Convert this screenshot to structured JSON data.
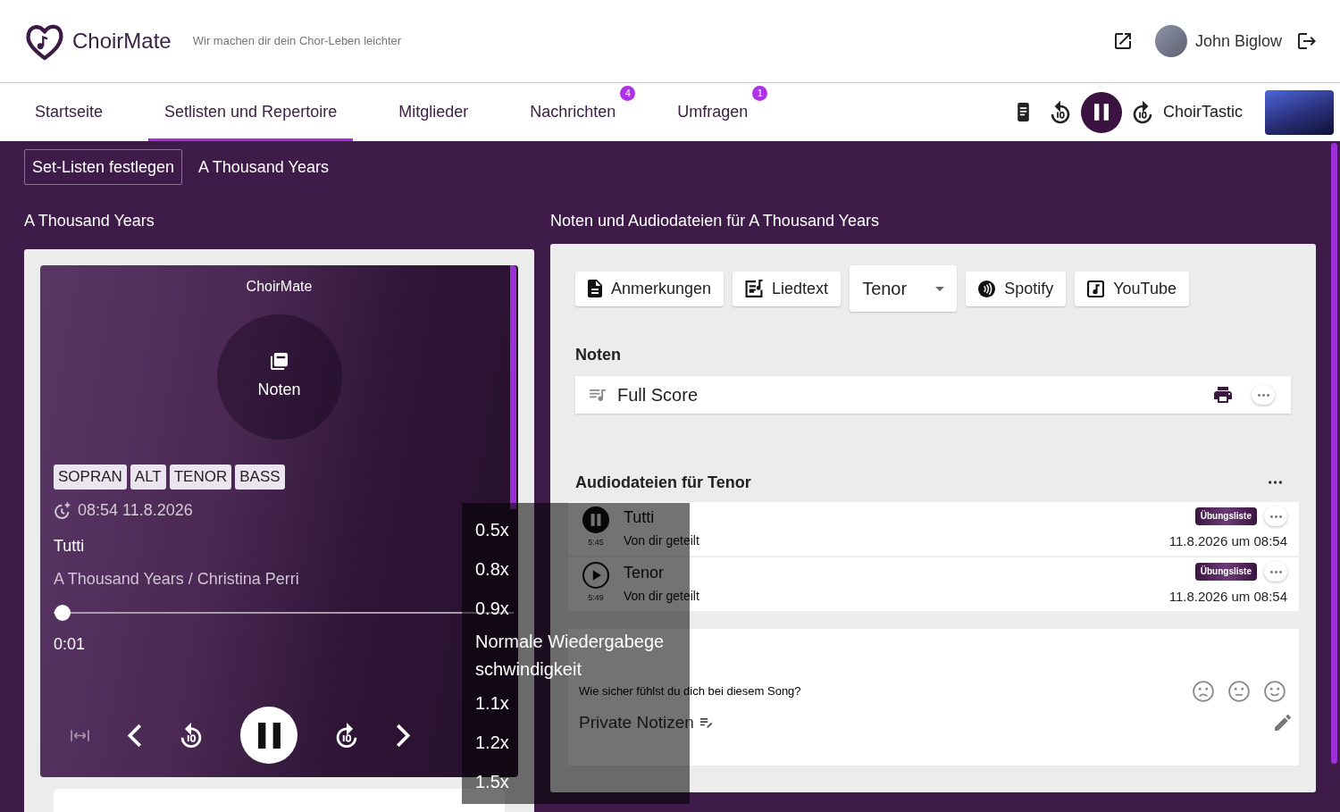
{
  "header": {
    "brand": "ChoirMate",
    "tagline": "Wir machen dir dein Chor-Leben leichter",
    "user_name": "John Biglow"
  },
  "nav": {
    "tabs": [
      {
        "label": "Startseite",
        "selected": false
      },
      {
        "label": "Setlisten und Repertoire",
        "selected": true
      },
      {
        "label": "Mitglieder",
        "selected": false
      },
      {
        "label": "Nachrichten",
        "selected": false,
        "badge": "4"
      },
      {
        "label": "Umfragen",
        "selected": false,
        "badge": "1"
      }
    ],
    "mini_player": {
      "title": "ChoirTastic",
      "playing": true
    }
  },
  "breadcrumb": [
    {
      "label": "Set-Listen festlegen",
      "kind": "button"
    },
    {
      "label": "A Thousand Years",
      "kind": "text"
    }
  ],
  "song": {
    "heading": "A Thousand Years",
    "player": {
      "brand": "ChoirMate",
      "cover_label": "Noten",
      "voices": [
        "SOPRAN",
        "ALT",
        "TENOR",
        "BASS"
      ],
      "added": "08:54 11.8.2026",
      "track": "Tutti",
      "subtitle": "A Thousand Years / Christina Perri",
      "level": 0.003,
      "elapsed": "0:01",
      "playing": true
    }
  },
  "files": {
    "heading": "Noten und Audiodateien für A Thousand Years",
    "actions": [
      {
        "label": "Anmerkungen",
        "kind": "button"
      },
      {
        "label": "Liedtext",
        "kind": "button"
      },
      {
        "label": "Tenor",
        "kind": "select"
      },
      {
        "label": "Spotify",
        "kind": "button"
      },
      {
        "label": "YouTube",
        "kind": "button"
      }
    ],
    "scores_heading": "Noten",
    "scores": [
      {
        "title": "Full Score"
      }
    ],
    "audio_heading": "Audiodateien für Tenor",
    "audio": [
      {
        "title": "Tutti",
        "duration": "5:45",
        "shared": "Von dir geteilt",
        "tag": "Übungsliste",
        "date": "11.8.2026 um 08:54",
        "playing": true
      },
      {
        "title": "Tenor",
        "duration": "5:49",
        "shared": "Von dir geteilt",
        "tag": "Übungsliste",
        "date": "11.8.2026 um 08:54",
        "playing": false
      }
    ],
    "feedback": {
      "question": "Wie sicher fühlst du dich bei diesem Song?",
      "notes_label": "Private Notizen"
    }
  },
  "speed_menu": {
    "options": [
      "0.5x",
      "0.8x",
      "0.9x",
      "Normale Wiedergabegeschwindigkeit",
      "1.1x",
      "1.2x",
      "1.5x"
    ]
  }
}
